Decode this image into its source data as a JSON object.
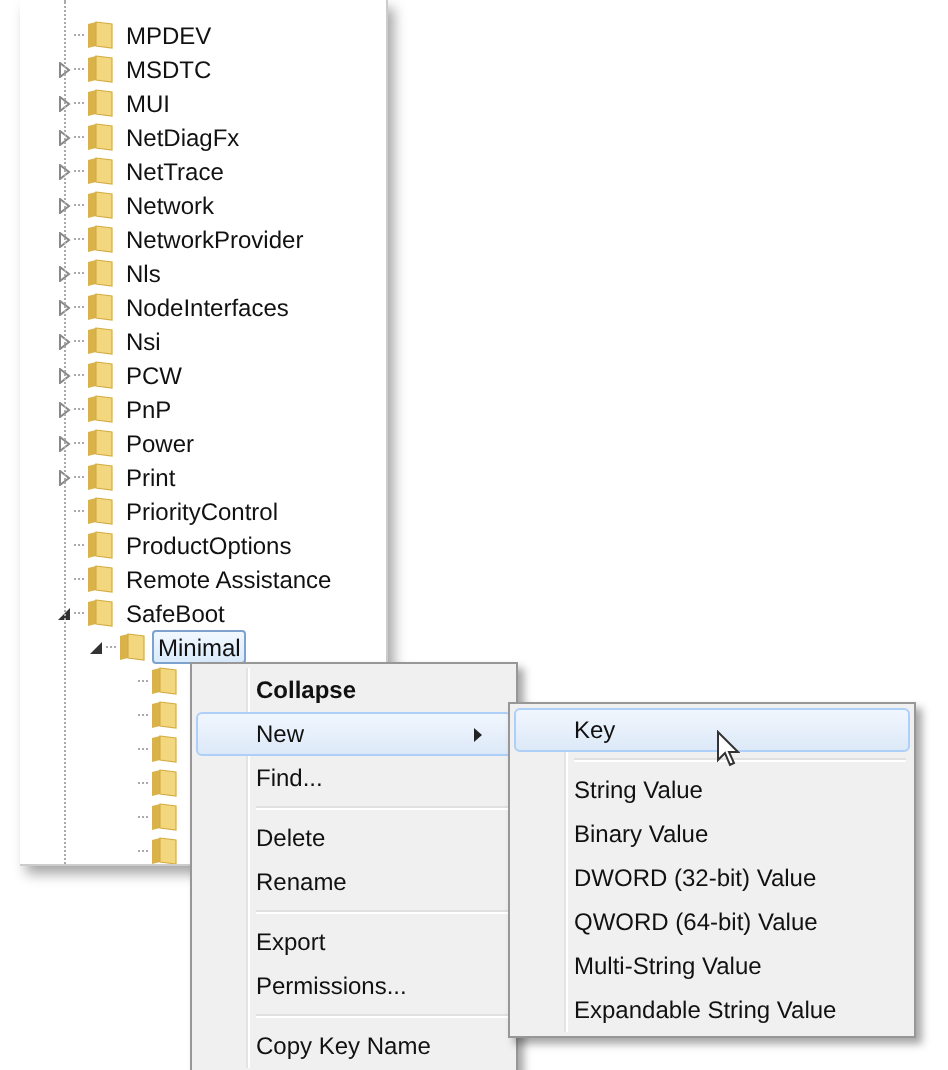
{
  "tree": [
    {
      "label": "MPDEV",
      "expandable": false,
      "selected": false
    },
    {
      "label": "MSDTC",
      "expandable": true,
      "expanded": false,
      "selected": false
    },
    {
      "label": "MUI",
      "expandable": true,
      "expanded": false,
      "selected": false
    },
    {
      "label": "NetDiagFx",
      "expandable": true,
      "expanded": false,
      "selected": false
    },
    {
      "label": "NetTrace",
      "expandable": true,
      "expanded": false,
      "selected": false
    },
    {
      "label": "Network",
      "expandable": true,
      "expanded": false,
      "selected": false
    },
    {
      "label": "NetworkProvider",
      "expandable": true,
      "expanded": false,
      "selected": false
    },
    {
      "label": "Nls",
      "expandable": true,
      "expanded": false,
      "selected": false
    },
    {
      "label": "NodeInterfaces",
      "expandable": true,
      "expanded": false,
      "selected": false
    },
    {
      "label": "Nsi",
      "expandable": true,
      "expanded": false,
      "selected": false
    },
    {
      "label": "PCW",
      "expandable": true,
      "expanded": false,
      "selected": false
    },
    {
      "label": "PnP",
      "expandable": true,
      "expanded": false,
      "selected": false
    },
    {
      "label": "Power",
      "expandable": true,
      "expanded": false,
      "selected": false
    },
    {
      "label": "Print",
      "expandable": true,
      "expanded": false,
      "selected": false
    },
    {
      "label": "PriorityControl",
      "expandable": false,
      "selected": false
    },
    {
      "label": "ProductOptions",
      "expandable": false,
      "selected": false
    },
    {
      "label": "Remote Assistance",
      "expandable": false,
      "selected": false
    },
    {
      "label": "SafeBoot",
      "expandable": true,
      "expanded": true,
      "selected": false,
      "children": [
        {
          "label": "Minimal",
          "expandable": true,
          "expanded": true,
          "selected": true,
          "children": [
            {
              "expandable": false
            },
            {
              "expandable": false
            },
            {
              "expandable": false
            },
            {
              "expandable": false
            },
            {
              "expandable": false
            },
            {
              "expandable": false
            }
          ]
        }
      ]
    }
  ],
  "context_menu": [
    {
      "kind": "item",
      "label": "Collapse",
      "bold": true,
      "selected": false,
      "submenu": false
    },
    {
      "kind": "item",
      "label": "New",
      "bold": false,
      "selected": true,
      "submenu": true
    },
    {
      "kind": "item",
      "label": "Find...",
      "bold": false,
      "selected": false,
      "submenu": false
    },
    {
      "kind": "separator"
    },
    {
      "kind": "item",
      "label": "Delete",
      "bold": false,
      "selected": false,
      "submenu": false
    },
    {
      "kind": "item",
      "label": "Rename",
      "bold": false,
      "selected": false,
      "submenu": false
    },
    {
      "kind": "separator"
    },
    {
      "kind": "item",
      "label": "Export",
      "bold": false,
      "selected": false,
      "submenu": false
    },
    {
      "kind": "item",
      "label": "Permissions...",
      "bold": false,
      "selected": false,
      "submenu": false
    },
    {
      "kind": "separator"
    },
    {
      "kind": "item",
      "label": "Copy Key Name",
      "bold": false,
      "selected": false,
      "submenu": false
    }
  ],
  "submenu": [
    {
      "kind": "item",
      "label": "Key",
      "bold": false,
      "selected": true,
      "submenu": false
    },
    {
      "kind": "separator"
    },
    {
      "kind": "item",
      "label": "String Value",
      "bold": false,
      "selected": false,
      "submenu": false
    },
    {
      "kind": "item",
      "label": "Binary Value",
      "bold": false,
      "selected": false,
      "submenu": false
    },
    {
      "kind": "item",
      "label": "DWORD (32-bit) Value",
      "bold": false,
      "selected": false,
      "submenu": false
    },
    {
      "kind": "item",
      "label": "QWORD (64-bit) Value",
      "bold": false,
      "selected": false,
      "submenu": false
    },
    {
      "kind": "item",
      "label": "Multi-String Value",
      "bold": false,
      "selected": false,
      "submenu": false
    },
    {
      "kind": "item",
      "label": "Expandable String Value",
      "bold": false,
      "selected": false,
      "submenu": false
    }
  ]
}
